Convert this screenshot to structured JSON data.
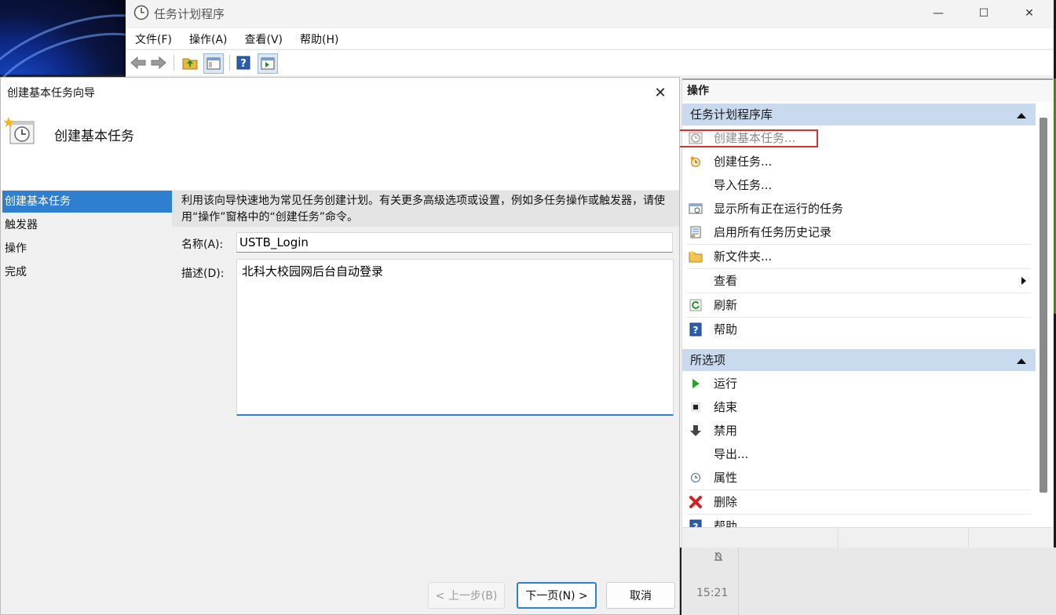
{
  "app": {
    "title": "任务计划程序",
    "menu": [
      "文件(F)",
      "操作(A)",
      "查看(V)",
      "帮助(H)"
    ],
    "caption": {
      "minimize": "—",
      "maximize": "☐",
      "close": "✕"
    }
  },
  "actions": {
    "header": "操作",
    "sections": [
      {
        "title": "任务计划程序库",
        "items": [
          {
            "label": "创建基本任务...",
            "icon": "clock-task-icon",
            "disabled": true
          },
          {
            "label": "创建任务...",
            "icon": "task-icon"
          },
          {
            "label": "导入任务...",
            "icon": "none"
          },
          {
            "label": "显示所有正在运行的任务",
            "icon": "running-tasks-icon"
          },
          {
            "label": "启用所有任务历史记录",
            "icon": "history-icon"
          },
          {
            "label": "新文件夹...",
            "icon": "folder-icon"
          },
          {
            "label": "查看",
            "icon": "none",
            "submenu": true
          },
          {
            "label": "刷新",
            "icon": "refresh-icon"
          },
          {
            "label": "帮助",
            "icon": "help-icon"
          }
        ]
      },
      {
        "title": "所选项",
        "items": [
          {
            "label": "运行",
            "icon": "run-icon"
          },
          {
            "label": "结束",
            "icon": "stop-icon"
          },
          {
            "label": "禁用",
            "icon": "disable-icon"
          },
          {
            "label": "导出...",
            "icon": "none"
          },
          {
            "label": "属性",
            "icon": "properties-icon"
          },
          {
            "label": "删除",
            "icon": "delete-icon"
          },
          {
            "label": "帮助",
            "icon": "help-icon"
          }
        ]
      }
    ]
  },
  "wizard": {
    "title": "创建基本任务向导",
    "close": "✕",
    "heading": "创建基本任务",
    "nav": [
      "创建基本任务",
      "触发器",
      "操作",
      "完成"
    ],
    "active_step": 0,
    "description": "利用该向导快速地为常见任务创建计划。有关更多高级选项或设置，例如多任务操作或触发器，请使用“操作”窗格中的“创建任务”命令。",
    "name_label": "名称(A):",
    "name_value": "USTB_Login",
    "desc_label": "描述(D):",
    "desc_value": "北科大校园网后台自动登录",
    "buttons": {
      "back": "< 上一步(B)",
      "next": "下一页(N) >",
      "cancel": "取消"
    }
  },
  "taskbar": {
    "time": "15:21"
  },
  "colors": {
    "accent": "#2f7fd0",
    "section_bg": "#c9d9ee",
    "highlight": "#d63030"
  }
}
